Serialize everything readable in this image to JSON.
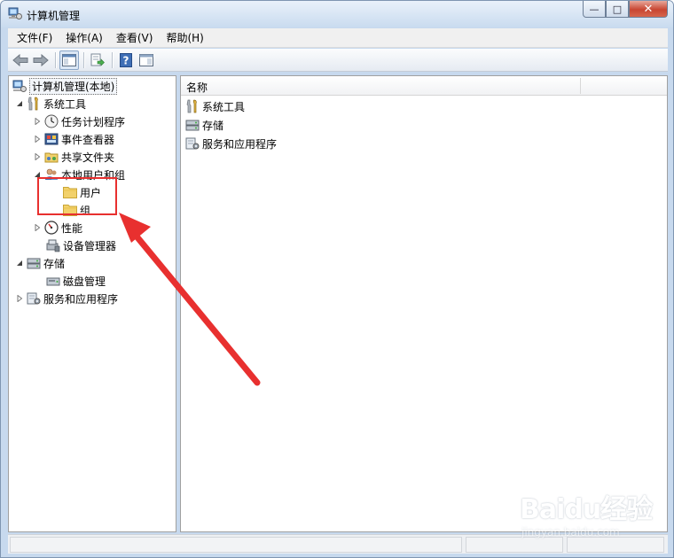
{
  "window": {
    "title": "计算机管理",
    "controls": {
      "minimize": "—",
      "maximize": "□",
      "close": "✕"
    }
  },
  "menu": [
    {
      "label": "文件(F)"
    },
    {
      "label": "操作(A)"
    },
    {
      "label": "查看(V)"
    },
    {
      "label": "帮助(H)"
    }
  ],
  "toolbar": {
    "buttons": [
      "back-arrow-icon",
      "forward-arrow-icon",
      "show-hide-tree-icon",
      "export-list-icon",
      "help-icon",
      "action-pane-icon"
    ]
  },
  "tree": {
    "root": "计算机管理(本地)",
    "system_tools": "系统工具",
    "task_scheduler": "任务计划程序",
    "event_viewer": "事件查看器",
    "shared_folders": "共享文件夹",
    "local_users_groups": "本地用户和组",
    "users": "用户",
    "groups": "组",
    "performance": "性能",
    "device_manager": "设备管理器",
    "storage": "存储",
    "disk_management": "磁盘管理",
    "services_apps": "服务和应用程序"
  },
  "list": {
    "column_name": "名称",
    "items": [
      "系统工具",
      "存储",
      "服务和应用程序"
    ]
  },
  "watermark": {
    "logo": "Baidu经验",
    "url": "jingyan.baidu.com"
  },
  "colors": {
    "annotation": "#e8302f",
    "folder": "#f2d16b"
  }
}
